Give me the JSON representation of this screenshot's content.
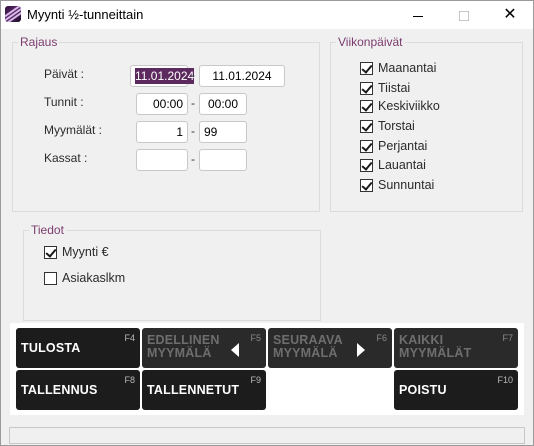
{
  "window": {
    "title": "Myynti ½-tunneittain"
  },
  "rajaus": {
    "title": "Rajaus",
    "paivat": {
      "label": "Päivät :",
      "from": "11.01.2024",
      "to": "11.01.2024"
    },
    "tunnit": {
      "label": "Tunnit :",
      "from": "00:00",
      "to": "00:00"
    },
    "myymalat": {
      "label": "Myymälät :",
      "from": "1",
      "to": "99"
    },
    "kassat": {
      "label": "Kassat :",
      "from": "",
      "to": ""
    },
    "separator": "-"
  },
  "viikonpaivat": {
    "title": "Viikonpäivät",
    "days": [
      {
        "label": "Maanantai",
        "checked": true
      },
      {
        "label": "Tiistai",
        "checked": true
      },
      {
        "label": "Keskiviikko",
        "checked": true
      },
      {
        "label": "Torstai",
        "checked": true
      },
      {
        "label": "Perjantai",
        "checked": true
      },
      {
        "label": "Lauantai",
        "checked": true
      },
      {
        "label": "Sunnuntai",
        "checked": true
      }
    ]
  },
  "tiedot": {
    "title": "Tiedot",
    "options": [
      {
        "label": "Myynti €",
        "checked": true
      },
      {
        "label": "Asiakaslkm",
        "checked": false
      }
    ]
  },
  "buttons": {
    "tulosta": {
      "label": "TULOSTA",
      "key": "F4"
    },
    "edellinen": {
      "line1": "EDELLINEN",
      "line2": "MYYMÄLÄ",
      "key": "F5"
    },
    "seuraava": {
      "line1": "SEURAAVA",
      "line2": "MYYMÄLÄ",
      "key": "F6"
    },
    "kaikki": {
      "line1": "KAIKKI",
      "line2": "MYYMÄLÄT",
      "key": "F7"
    },
    "tallennus": {
      "label": "TALLENNUS",
      "key": "F8"
    },
    "tallennetut": {
      "label": "TALLENNETUT",
      "key": "F9"
    },
    "poistu": {
      "label": "POISTU",
      "key": "F10"
    }
  },
  "icons": {
    "app": "app-logo-icon",
    "minimize": "minimize-icon",
    "maximize": "maximize-icon",
    "close": "close-icon"
  },
  "colors": {
    "accent": "#7a3c6e",
    "selection": "#5c2a5e",
    "button_bg": "#1c1c1c"
  }
}
